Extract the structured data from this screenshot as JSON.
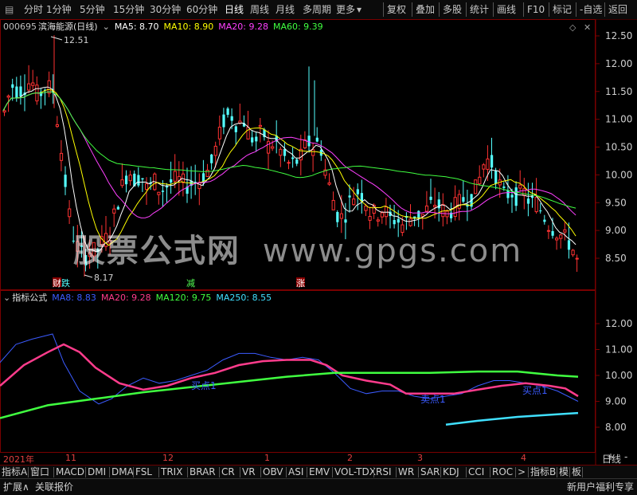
{
  "toolbar": {
    "periods": [
      "分时",
      "1分钟",
      "5分钟",
      "15分钟",
      "30分钟",
      "60分钟",
      "日线",
      "周线",
      "月线",
      "多周期",
      "更多"
    ],
    "actions": [
      "复权",
      "叠加",
      "多股",
      "统计",
      "画线",
      "F10",
      "标记",
      "-自选",
      "返回"
    ]
  },
  "stock": {
    "code": "000695",
    "name": "滨海能源(日线)"
  },
  "ma_main": [
    {
      "label": "MA5: 8.70",
      "color": "#ffffff"
    },
    {
      "label": "MA10: 8.90",
      "color": "#ffff00"
    },
    {
      "label": "MA20: 9.28",
      "color": "#ff40ff"
    },
    {
      "label": "MA60: 9.39",
      "color": "#40ff40"
    }
  ],
  "price_axis": [
    "12.50",
    "12.00",
    "11.50",
    "11.00",
    "10.50",
    "10.00",
    "9.50",
    "9.00",
    "8.50"
  ],
  "high_mark": "12.51",
  "low_mark": "8.17",
  "markers": {
    "m1": "财",
    "m2": "跌",
    "m3": "减",
    "m4": "涨"
  },
  "watermark": {
    "cn": "股票公式网",
    "en": "www.gpgs.com"
  },
  "indicator": {
    "name": "指标公式",
    "lines": [
      {
        "label": "MA8: 8.83",
        "color": "#3b5bff"
      },
      {
        "label": "MA20: 9.28",
        "color": "#ff3c8c"
      },
      {
        "label": "MA120: 9.75",
        "color": "#40ff40"
      },
      {
        "label": "MA250: 8.55",
        "color": "#40e0ff"
      }
    ],
    "axis": [
      "12.00",
      "11.00",
      "10.00",
      "9.00",
      "8.00"
    ],
    "notes": [
      "买点1",
      "卖点1",
      "买点1"
    ]
  },
  "dates": {
    "year": "2021年",
    "m11": "11",
    "m12": "12",
    "m1": "1",
    "m2": "2",
    "m3": "3",
    "m4": "4",
    "period": "日线"
  },
  "indicator_tabs": [
    "指标A",
    "窗口",
    "MACD",
    "DMI",
    "DMA",
    "FSL",
    "TRIX",
    "BRAR",
    "CR",
    "VR",
    "OBV",
    "ASI",
    "EMV",
    "VOL-TDX",
    "RSI",
    "WR",
    "SAR",
    "KDJ",
    "CCI",
    "ROC",
    ">",
    "指标B",
    "模",
    "板"
  ],
  "status": {
    "left": "扩展∧",
    "quote": "关联报价",
    "right": "新用户福利专享"
  },
  "colors": {
    "up": "#ff3232",
    "down": "#54ffff",
    "bg": "#000000",
    "grid": "#7a0000"
  },
  "icons": {
    "collapse": "chevron-down-icon",
    "diamond": "diamond-icon",
    "close": "close-icon"
  }
}
